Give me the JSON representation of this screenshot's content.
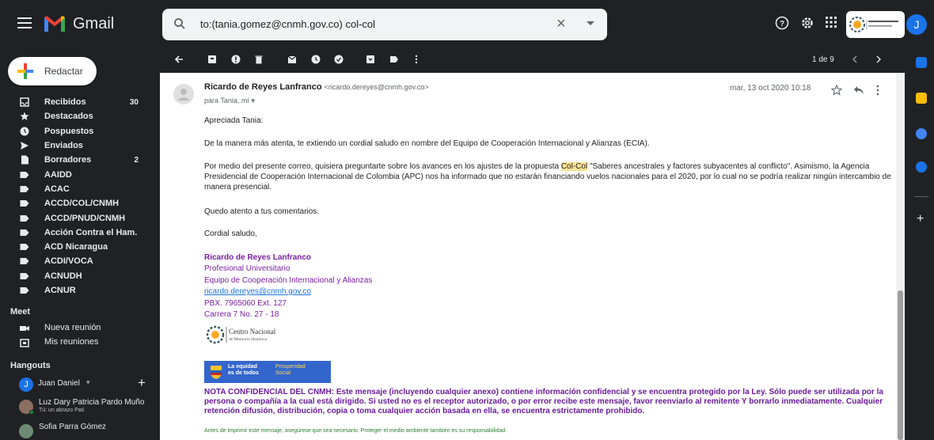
{
  "app": {
    "name": "Gmail"
  },
  "search": {
    "value": "to:(tania.gomez@cnmh.gov.co) col-col"
  },
  "account": {
    "avatar_letter": "J",
    "org_name": "Centro Nacional de Memoria Histórica"
  },
  "compose": {
    "label": "Redactar"
  },
  "nav": [
    {
      "label": "Recibidos",
      "count": "30",
      "icon": "inbox-icon"
    },
    {
      "label": "Destacados",
      "count": "",
      "icon": "star-icon"
    },
    {
      "label": "Pospuestos",
      "count": "",
      "icon": "clock-icon"
    },
    {
      "label": "Enviados",
      "count": "",
      "icon": "send-icon"
    },
    {
      "label": "Borradores",
      "count": "2",
      "icon": "draft-icon"
    },
    {
      "label": "AAIDD",
      "count": "",
      "icon": "label-icon"
    },
    {
      "label": "ACAC",
      "count": "",
      "icon": "label-icon"
    },
    {
      "label": "ACCD/COL/CNMH",
      "count": "",
      "icon": "label-icon"
    },
    {
      "label": "ACCD/PNUD/CNMH",
      "count": "",
      "icon": "label-icon"
    },
    {
      "label": "Acción Contra el Ham...",
      "count": "",
      "icon": "label-icon"
    },
    {
      "label": "ACD Nicaragua",
      "count": "",
      "icon": "label-icon"
    },
    {
      "label": "ACDI/VOCA",
      "count": "",
      "icon": "label-icon"
    },
    {
      "label": "ACNUDH",
      "count": "",
      "icon": "label-icon"
    },
    {
      "label": "ACNUR",
      "count": "",
      "icon": "label-icon"
    }
  ],
  "meet": {
    "heading": "Meet",
    "new_meeting": "Nueva reunión",
    "my_meetings": "Mis reuniones"
  },
  "hangouts": {
    "heading": "Hangouts",
    "user": "Juan Daniel",
    "user_letter": "J",
    "contacts": [
      {
        "name": "Luz Dary Patricia Pardo Muño",
        "sub": "Tú: un abrazo Pati"
      },
      {
        "name": "Sofia Parra Gómez",
        "sub": ""
      }
    ]
  },
  "toolbar": {
    "pager": "1 de 9"
  },
  "message": {
    "from_name": "Ricardo de Reyes Lanfranco",
    "from_email": "<ricardo.dereyes@cnmh.gov.co>",
    "to": "para Tania, mí",
    "date": "mar, 13 oct 2020 10:18",
    "greeting": "Apreciada Tania:",
    "p1": "De la manera más atenta, te extiendo un cordial saludo en nombre del Equipo de Cooperación Internacional y Alianzas (ECIA).",
    "p2_before": "Por medio del presente correo, quisiera preguntarte sobre los avances en los ajustes de la propuesta ",
    "p2_highlight": "Col-Col",
    "p2_after": " \"Saberes ancestrales y factores subyacentes al conflicto\". Asimismo, la Agencia Presidencial de Cooperación Internacional de Colombia (APC) nos ha informado que no estarán financiando vuelos nacionales para el 2020, por lo cual no se podría realizar ningún intercambio de manera presencial.",
    "p3": "Quedo atento a tus comentarios.",
    "closing": "Cordial saludo,",
    "sig_name": "Ricardo de Reyes Lanfranco",
    "sig_role": "Profesional Universitario",
    "sig_team": "Equipo de Cooperación Internacional y Alianzas",
    "sig_email": "ricardo.dereyes@cnmh.gov.co",
    "sig_phone": "PBX. 7965060 Ext. 127",
    "sig_address": "Carrera 7 No. 27 - 18",
    "logo_text_1": "Centro Nacional",
    "logo_text_2": "de Memoria Histórica",
    "gov_text_1": "La equidad",
    "gov_text_2": "es de todos",
    "gov_text_3": "Prosperidad",
    "gov_text_4": "Social",
    "nota": "NOTA CONFIDENCIAL DEL CNMH: Este mensaje (incluyendo cualquier anexo) contiene información confidencial y se encuentra protegido por la Ley. Sólo puede ser utilizada por la persona o compañía a la cual está dirigido. Si usted no es el receptor autorizado, o por error recibe este mensaje, favor reenviarlo al remitente Y borrarlo inmediatamente. Cualquier retención difusión, distribución, copia o toma cualquier acción basada en ella, se encuentra estrictamente prohibido.",
    "eco": "Antes de imprimir este mensaje, asegúrese que sea necesario. Proteger el medio ambiente también es su responsabilidad."
  },
  "colors": {
    "accent": "#1a73e8",
    "highlight": "#fde293",
    "signature": "#7b1fa2",
    "dark_bg": "#202124"
  }
}
